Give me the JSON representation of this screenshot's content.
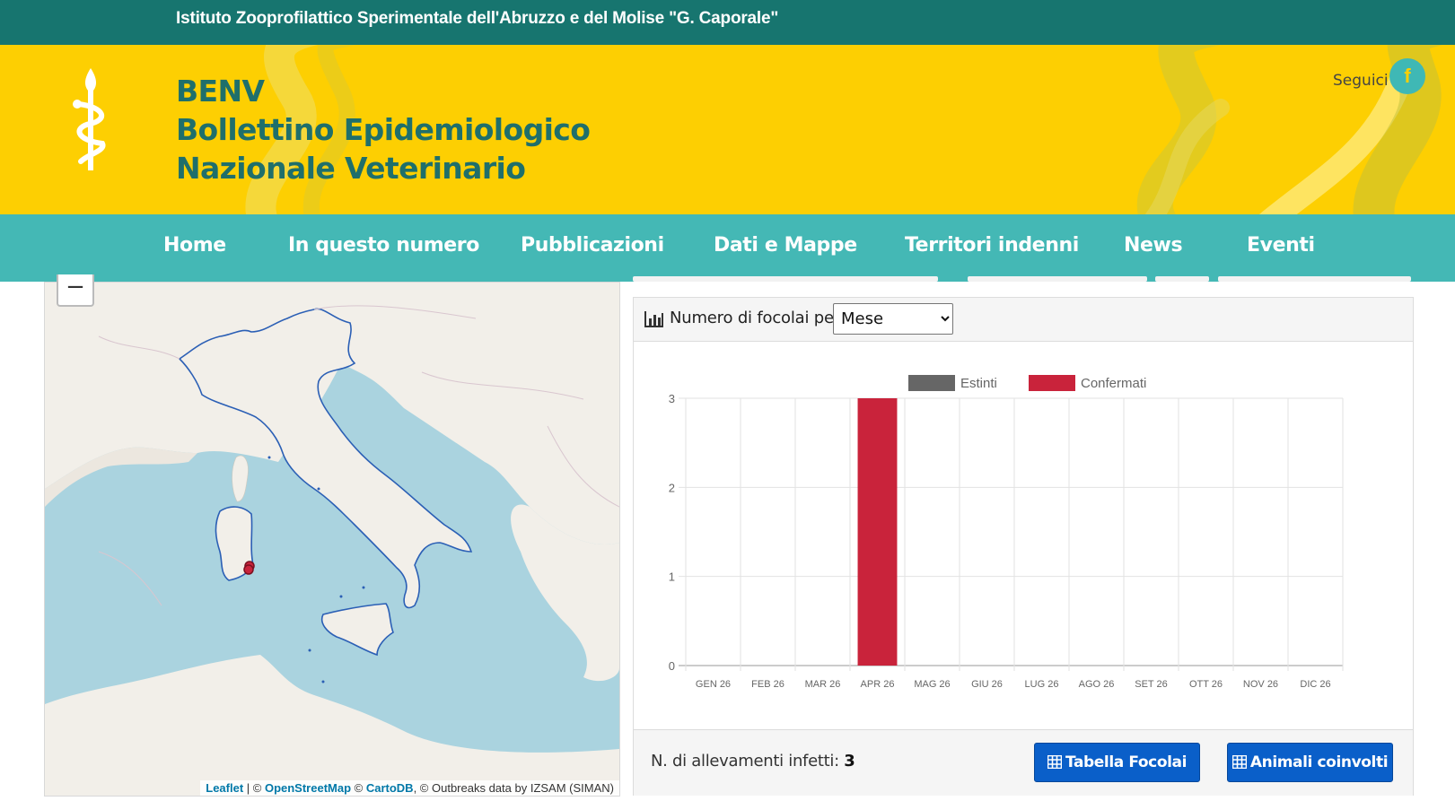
{
  "header": {
    "institute": "Istituto Zooprofilattico Sperimentale dell'Abruzzo e del Molise \"G. Caporale\"",
    "brand_lines": [
      "BENV",
      "Bollettino Epidemiologico",
      "Nazionale Veterinario"
    ],
    "follow_label": "Seguici",
    "facebook_glyph": "f"
  },
  "nav": {
    "items": [
      "Home",
      "In questo numero",
      "Pubblicazioni",
      "Dati e Mappe",
      "Territori indenni",
      "News",
      "Eventi"
    ]
  },
  "map": {
    "zoom_out": "−",
    "attribution": {
      "leaflet": "Leaflet",
      "sep1": " | © ",
      "osm": "OpenStreetMap",
      "sep2": " © ",
      "carto": "CartoDB",
      "tail": ", © Outbreaks data by IZSAM (SIMAN)"
    }
  },
  "panel": {
    "title": "Numero di focolai per",
    "period_select": {
      "selected": "Mese",
      "options": [
        "Mese"
      ]
    },
    "infected_label": "N. di allevamenti infetti:",
    "infected_count": "3",
    "buttons": {
      "table": "Tabella Focolai",
      "animals": "Animali coinvolti"
    }
  },
  "colors": {
    "topbar": "#17756f",
    "banner": "#fdcf02",
    "nav": "#44b8b5",
    "brand_text": "#1f6f6b",
    "button": "#0a5fc9",
    "confermati": "#c9233b",
    "estinti": "#666666"
  },
  "chart_data": {
    "type": "bar",
    "categories": [
      "GEN 26",
      "FEB 26",
      "MAR 26",
      "APR 26",
      "MAG 26",
      "GIU 26",
      "LUG 26",
      "AGO 26",
      "SET 26",
      "OTT 26",
      "NOV 26",
      "DIC 26"
    ],
    "series": [
      {
        "name": "Estinti",
        "values": [
          0,
          0,
          0,
          0,
          0,
          0,
          0,
          0,
          0,
          0,
          0,
          0
        ],
        "color": "#666666"
      },
      {
        "name": "Confermati",
        "values": [
          0,
          0,
          0,
          3,
          0,
          0,
          0,
          0,
          0,
          0,
          0,
          0
        ],
        "color": "#c9233b"
      }
    ],
    "ylim": [
      0,
      3
    ],
    "yticks": [
      0,
      1,
      2,
      3
    ],
    "stacked": true,
    "legend": "top",
    "grid": true
  }
}
